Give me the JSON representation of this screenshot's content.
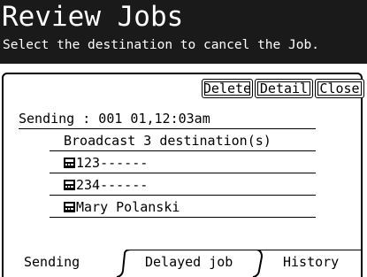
{
  "header": {
    "title": "Review Jobs",
    "subtitle": "Select the destination to cancel the Job."
  },
  "buttons": {
    "delete": "Delete",
    "detail": "Detail",
    "close": "Close"
  },
  "job": {
    "summary": "Sending : 001 01,12:03am",
    "broadcast": "Broadcast 3 destination(s)",
    "destinations": [
      "123------",
      "234------",
      "Mary Polanski"
    ]
  },
  "tabs": {
    "sending": "Sending",
    "delayed": "Delayed job",
    "history": "History",
    "active": "sending"
  },
  "colors": {
    "header_bg": "#1a1a1a",
    "header_fg": "#ffffff"
  },
  "icons": {
    "destination": "fax-icon"
  }
}
